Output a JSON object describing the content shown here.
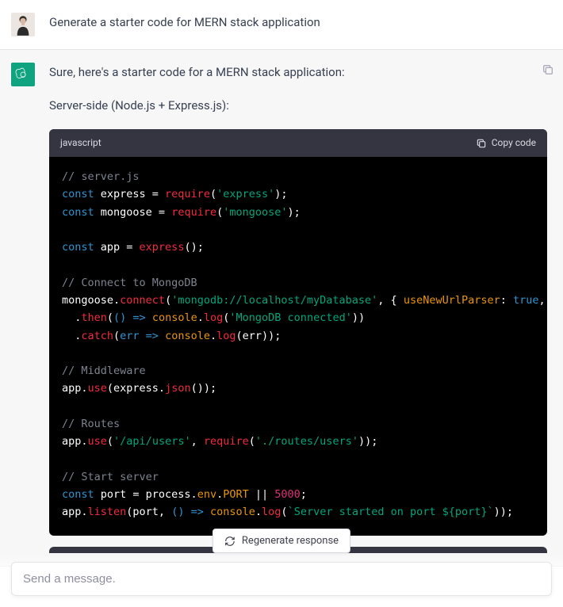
{
  "user_message": "Generate a starter code for MERN stack application",
  "assistant": {
    "intro": "Sure, here's a starter code for a MERN stack application:",
    "section_label": "Server-side (Node.js + Express.js):",
    "code_lang": "javascript",
    "copy_label": "Copy code"
  },
  "regenerate_label": "Regenerate response",
  "composer_placeholder": "Send a message.",
  "code": {
    "c1": "// server.js",
    "c2_kw": "const",
    "c2_id": " express = ",
    "c2_fn": "require",
    "c2_p1": "(",
    "c2_str": "'express'",
    "c2_p2": ");",
    "c3_kw": "const",
    "c3_id": " mongoose = ",
    "c3_fn": "require",
    "c3_p1": "(",
    "c3_str": "'mongoose'",
    "c3_p2": ");",
    "c4_kw": "const",
    "c4_id": " app = ",
    "c4_fn": "express",
    "c4_p": "();",
    "c5": "// Connect to MongoDB",
    "c6_a": "mongoose.",
    "c6_fn": "connect",
    "c6_p1": "(",
    "c6_str": "'mongodb://localhost/myDatabase'",
    "c6_p2": ", { ",
    "c6_pr": "useNewUrlParser",
    "c6_p3": ": ",
    "c6_lit": "true",
    "c6_p4": ",",
    "c7_a": "  .",
    "c7_fn": "then",
    "c7_p1": "(",
    "c7_arrow": "() =>",
    "c7_b": " ",
    "c7_pr": "console",
    "c7_p2": ".",
    "c7_fn2": "log",
    "c7_p3": "(",
    "c7_str": "'MongoDB connected'",
    "c7_p4": "))",
    "c8_a": "  .",
    "c8_fn": "catch",
    "c8_p1": "(",
    "c8_arrow": "err =>",
    "c8_b": " ",
    "c8_pr": "console",
    "c8_p2": ".",
    "c8_fn2": "log",
    "c8_p3": "(err));",
    "c9": "// Middleware",
    "c10_a": "app.",
    "c10_fn": "use",
    "c10_p1": "(express.",
    "c10_fn2": "json",
    "c10_p2": "());",
    "c11": "// Routes",
    "c12_a": "app.",
    "c12_fn": "use",
    "c12_p1": "(",
    "c12_str": "'/api/users'",
    "c12_p2": ", ",
    "c12_fn2": "require",
    "c12_p3": "(",
    "c12_str2": "'./routes/users'",
    "c12_p4": "));",
    "c13": "// Start server",
    "c14_kw": "const",
    "c14_a": " port = process.",
    "c14_pr": "env",
    "c14_b": ".",
    "c14_pr2": "PORT",
    "c14_c": " || ",
    "c14_num": "5000",
    "c14_d": ";",
    "c15_a": "app.",
    "c15_fn": "listen",
    "c15_p1": "(port, ",
    "c15_arrow": "() =>",
    "c15_b": " ",
    "c15_pr": "console",
    "c15_p2": ".",
    "c15_fn2": "log",
    "c15_p3": "(",
    "c15_str": "`Server started on port ${port}`",
    "c15_p4": "));"
  }
}
